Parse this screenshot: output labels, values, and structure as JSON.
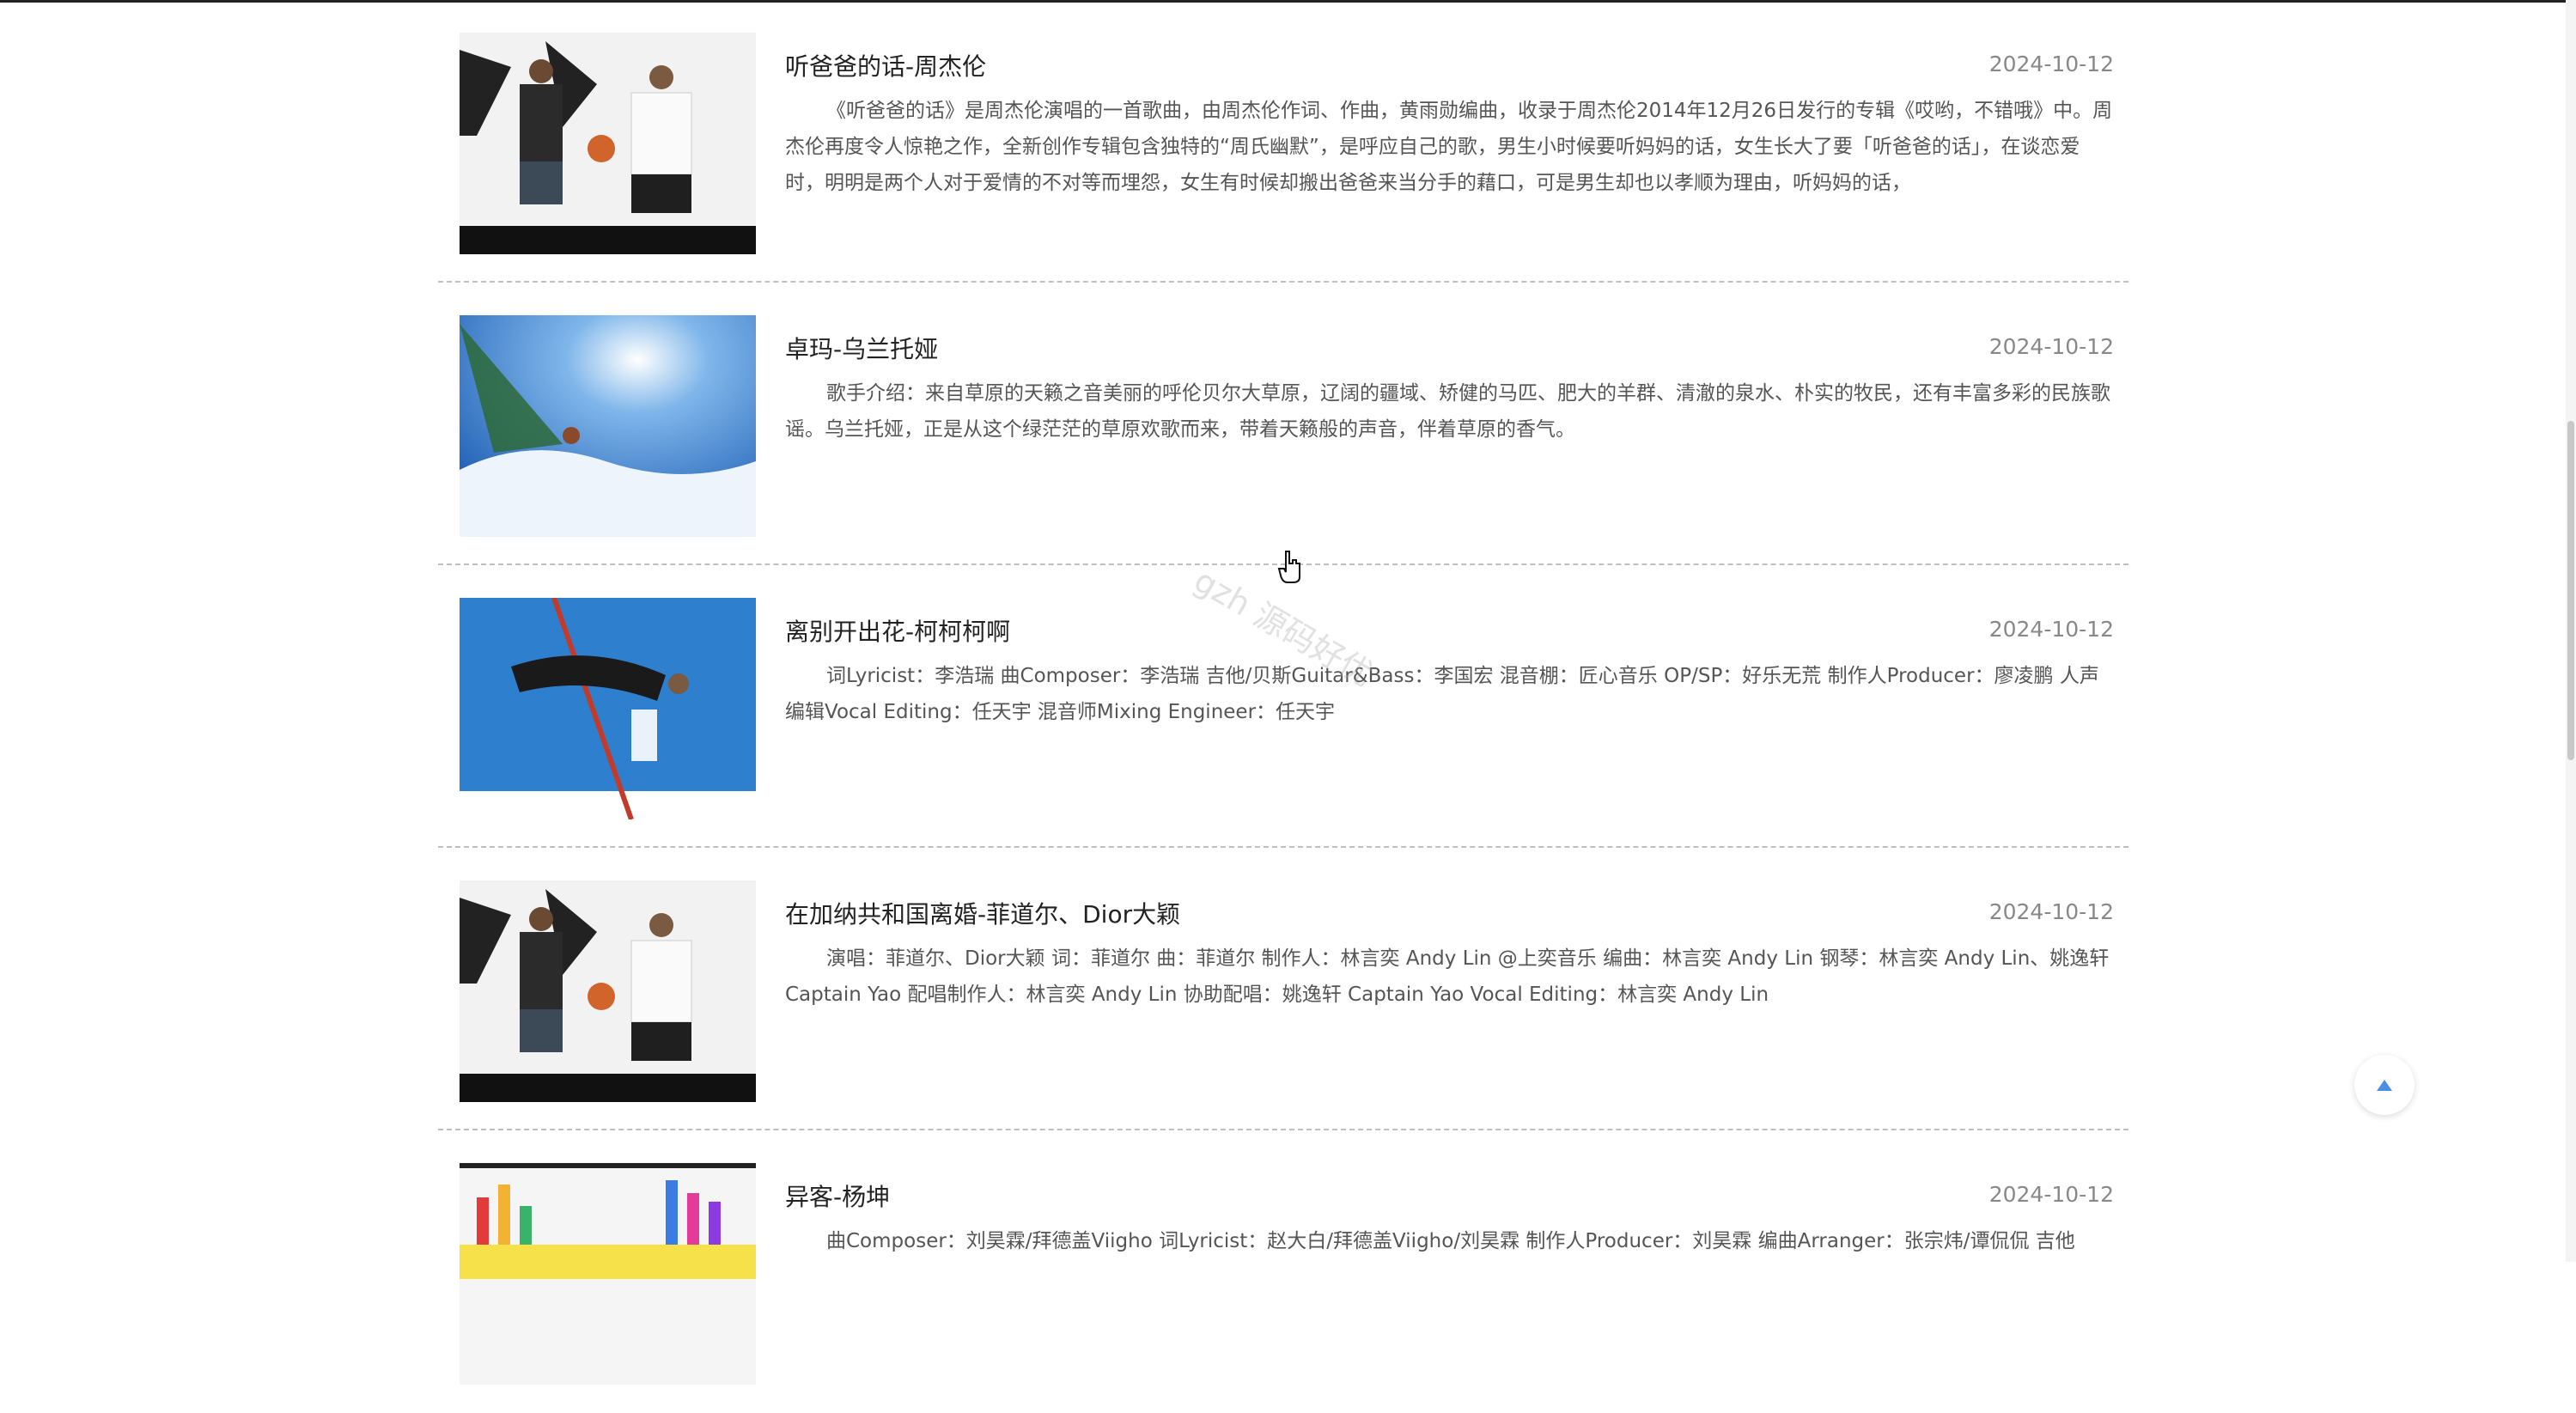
{
  "articles": [
    {
      "title": "听爸爸的话-周杰伦",
      "date": "2024-10-12",
      "desc": "《听爸爸的话》是周杰伦演唱的一首歌曲，由周杰伦作词、作曲，黄雨勋编曲，收录于周杰伦2014年12月26日发行的专辑《哎哟，不错哦》中。周杰伦再度令人惊艳之作，全新创作专辑包含独特的“周氏幽默”，是呼应自己的歌，男生小时候要听妈妈的话，女生长大了要「听爸爸的话」，在谈恋爱时，明明是两个人对于爱情的不对等而埋怨，女生有时候却搬出爸爸来当分手的藉口，可是男生却也以孝顺为理由，听妈妈的话，",
      "thumb": "basketball-image"
    },
    {
      "title": "卓玛-乌兰托娅",
      "date": "2024-10-12",
      "desc": "歌手介绍：来自草原的天籁之音美丽的呼伦贝尔大草原，辽阔的疆域、矫健的马匹、肥大的羊群、清澈的泉水、朴实的牧民，还有丰富多彩的民族歌谣。乌兰托娅，正是从这个绿茫茫的草原欢歌而来，带着天籁般的声音，伴着草原的香气。",
      "thumb": "windsurf-image"
    },
    {
      "title": "离别开出花-柯柯柯啊",
      "date": "2024-10-12",
      "desc": "词Lyricist：李浩瑞 曲Composer：李浩瑞 吉他/贝斯Guitar&Bass：李国宏 混音棚：匠心音乐 OP/SP：好乐无荒 制作人Producer：廖凌鹏 人声编辑Vocal Editing：任天宇 混音师Mixing Engineer：任天宇",
      "thumb": "highjump-image"
    },
    {
      "title": "在加纳共和国离婚-菲道尔、Dior大颖",
      "date": "2024-10-12",
      "desc": "演唱：菲道尔、Dior大颖 词：菲道尔 曲：菲道尔 制作人：林言奕 Andy Lin @上奕音乐 编曲：林言奕 Andy Lin 钢琴：林言奕 Andy Lin、姚逸轩 Captain Yao 配唱制作人：林言奕 Andy Lin 协助配唱：姚逸轩 Captain Yao Vocal Editing：林言奕 Andy Lin",
      "thumb": "basketball-image"
    },
    {
      "title": "异客-杨坤",
      "date": "2024-10-12",
      "desc": "曲Composer：刘昊霖/拜德盖Viigho 词Lyricist：赵大白/拜德盖Viigho/刘昊霖 制作人Producer：刘昊霖 编曲Arranger：张宗炜/谭侃侃 吉他",
      "thumb": "banner-image"
    }
  ],
  "watermark": "gzh 源码好优",
  "colors": {
    "accent": "#4a90e2",
    "divider": "#bfbfbf",
    "date": "#888888"
  }
}
